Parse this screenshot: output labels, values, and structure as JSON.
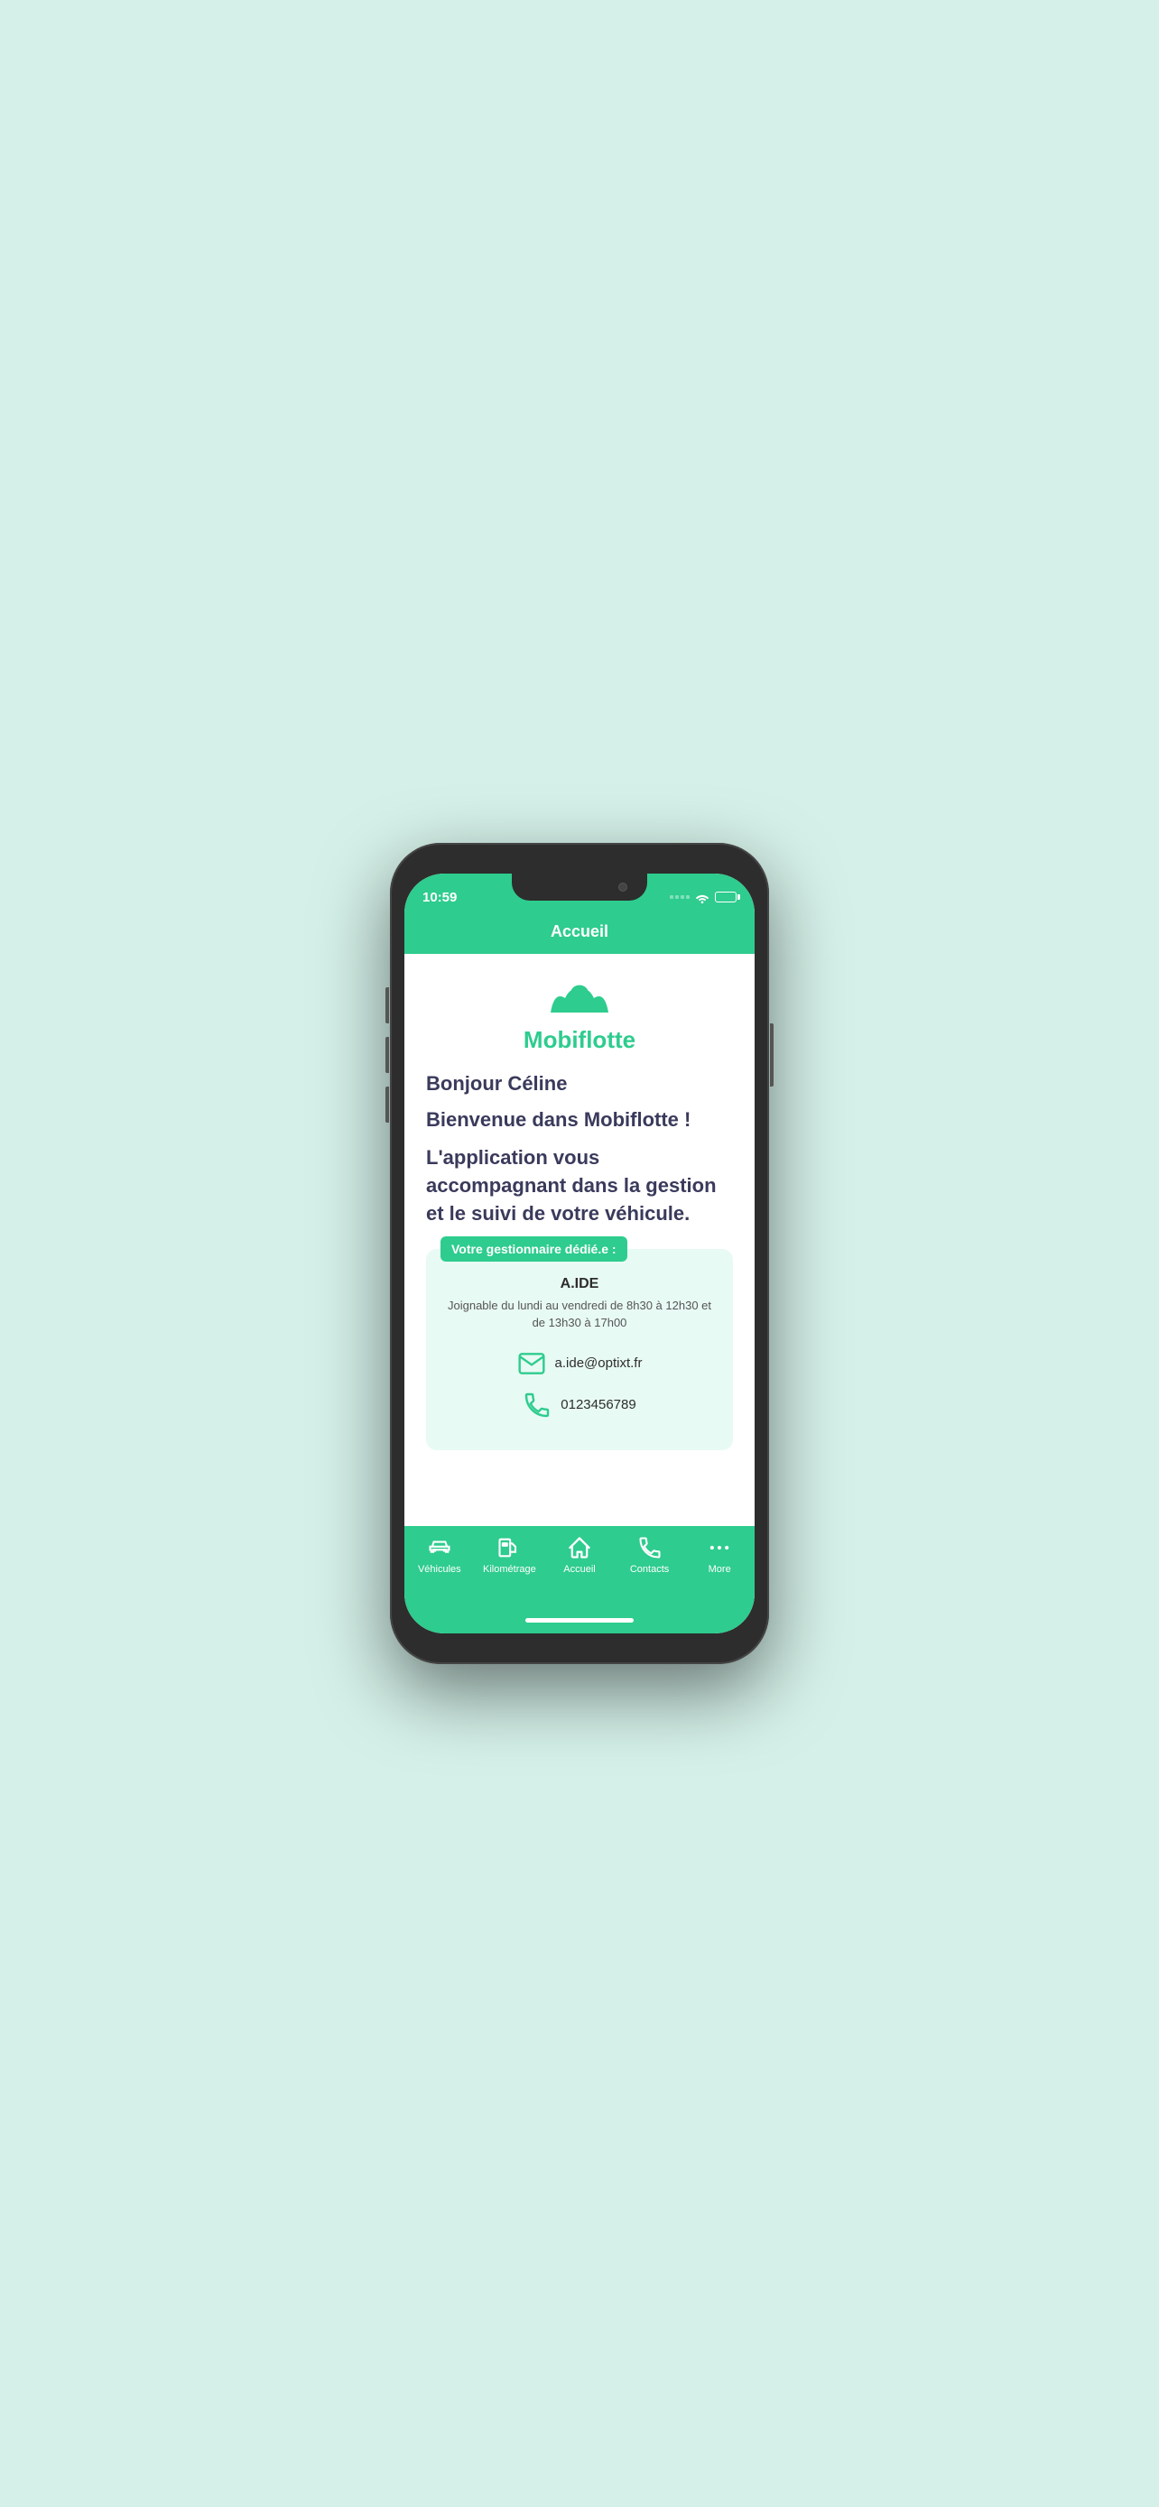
{
  "phone": {
    "time": "10:59"
  },
  "header": {
    "title": "Accueil"
  },
  "logo": {
    "name": "Mobiflotte"
  },
  "content": {
    "greeting": "Bonjour Céline",
    "welcome": "Bienvenue dans Mobiflotte !",
    "description": "L'application vous accompagnant dans la gestion et le suivi de votre véhicule.",
    "manager_badge": "Votre gestionnaire dédié.e :",
    "manager_name": "A.IDE",
    "manager_hours": "Joignable du lundi au vendredi de 8h30 à 12h30 et de 13h30 à 17h00",
    "manager_email": "a.ide@optixt.fr",
    "manager_phone": "0123456789"
  },
  "nav": {
    "items": [
      {
        "label": "Véhicules",
        "icon": "car"
      },
      {
        "label": "Kilométrage",
        "icon": "fuel"
      },
      {
        "label": "Accueil",
        "icon": "home",
        "active": true
      },
      {
        "label": "Contacts",
        "icon": "phone"
      },
      {
        "label": "More",
        "icon": "more"
      }
    ]
  }
}
